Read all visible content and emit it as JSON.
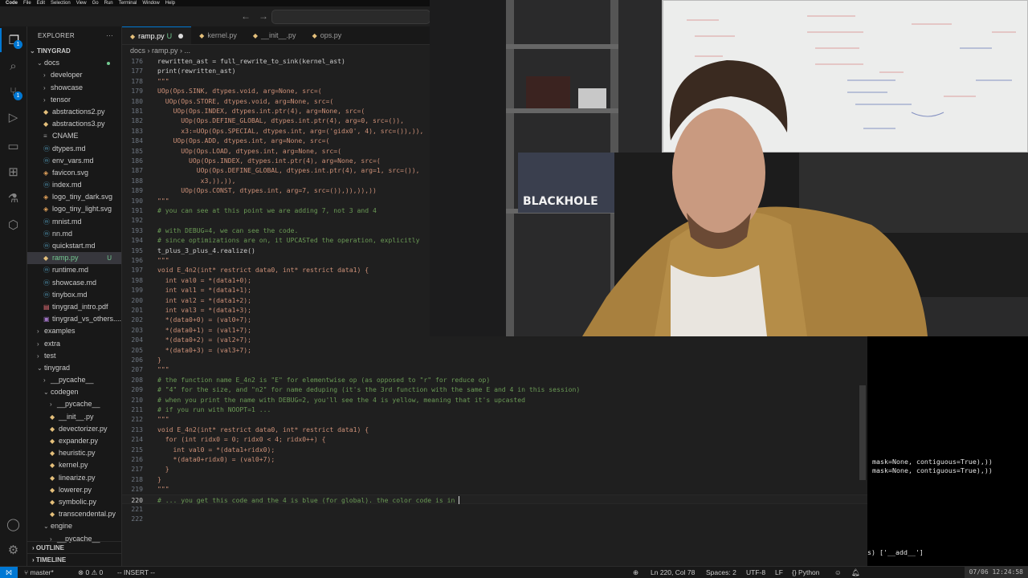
{
  "mac_menu": [
    "Code",
    "File",
    "Edit",
    "Selection",
    "View",
    "Go",
    "Run",
    "Terminal",
    "Window",
    "Help"
  ],
  "explorer": {
    "title": "EXPLORER",
    "more": "···",
    "root": "TINYGRAD",
    "items": [
      {
        "label": "docs",
        "level": 1,
        "kind": "folder",
        "open": true,
        "dot": true
      },
      {
        "label": "developer",
        "level": 2,
        "kind": "folder"
      },
      {
        "label": "showcase",
        "level": 2,
        "kind": "folder"
      },
      {
        "label": "tensor",
        "level": 2,
        "kind": "folder"
      },
      {
        "label": "abstractions2.py",
        "level": 2,
        "kind": "py"
      },
      {
        "label": "abstractions3.py",
        "level": 2,
        "kind": "py"
      },
      {
        "label": "CNAME",
        "level": 2,
        "kind": "txt"
      },
      {
        "label": "dtypes.md",
        "level": 2,
        "kind": "md"
      },
      {
        "label": "env_vars.md",
        "level": 2,
        "kind": "md"
      },
      {
        "label": "favicon.svg",
        "level": 2,
        "kind": "svg"
      },
      {
        "label": "index.md",
        "level": 2,
        "kind": "md"
      },
      {
        "label": "logo_tiny_dark.svg",
        "level": 2,
        "kind": "svg"
      },
      {
        "label": "logo_tiny_light.svg",
        "level": 2,
        "kind": "svg"
      },
      {
        "label": "mnist.md",
        "level": 2,
        "kind": "md"
      },
      {
        "label": "nn.md",
        "level": 2,
        "kind": "md"
      },
      {
        "label": "quickstart.md",
        "level": 2,
        "kind": "md"
      },
      {
        "label": "ramp.py",
        "level": 2,
        "kind": "py",
        "selected": true,
        "git": "U"
      },
      {
        "label": "runtime.md",
        "level": 2,
        "kind": "md"
      },
      {
        "label": "showcase.md",
        "level": 2,
        "kind": "md"
      },
      {
        "label": "tinybox.md",
        "level": 2,
        "kind": "md"
      },
      {
        "label": "tinygrad_intro.pdf",
        "level": 2,
        "kind": "pdf"
      },
      {
        "label": "tinygrad_vs_others....",
        "level": 2,
        "kind": "img"
      },
      {
        "label": "examples",
        "level": 1,
        "kind": "folder"
      },
      {
        "label": "extra",
        "level": 1,
        "kind": "folder"
      },
      {
        "label": "test",
        "level": 1,
        "kind": "folder"
      },
      {
        "label": "tinygrad",
        "level": 1,
        "kind": "folder",
        "open": true
      },
      {
        "label": "__pycache__",
        "level": 2,
        "kind": "folder"
      },
      {
        "label": "codegen",
        "level": 2,
        "kind": "folder",
        "open": true
      },
      {
        "label": "__pycache__",
        "level": 3,
        "kind": "folder"
      },
      {
        "label": "__init__.py",
        "level": 3,
        "kind": "py"
      },
      {
        "label": "devectorizer.py",
        "level": 3,
        "kind": "py"
      },
      {
        "label": "expander.py",
        "level": 3,
        "kind": "py"
      },
      {
        "label": "heuristic.py",
        "level": 3,
        "kind": "py"
      },
      {
        "label": "kernel.py",
        "level": 3,
        "kind": "py"
      },
      {
        "label": "linearize.py",
        "level": 3,
        "kind": "py"
      },
      {
        "label": "lowerer.py",
        "level": 3,
        "kind": "py"
      },
      {
        "label": "symbolic.py",
        "level": 3,
        "kind": "py"
      },
      {
        "label": "transcendental.py",
        "level": 3,
        "kind": "py"
      },
      {
        "label": "engine",
        "level": 2,
        "kind": "folder",
        "open": true
      },
      {
        "label": "__pycache__",
        "level": 3,
        "kind": "folder"
      }
    ],
    "outline": "OUTLINE",
    "timeline": "TIMELINE"
  },
  "tabs": [
    {
      "label": "ramp.py",
      "suffix": "U",
      "active": true
    },
    {
      "label": "kernel.py"
    },
    {
      "label": "__init__.py"
    },
    {
      "label": "ops.py"
    }
  ],
  "breadcrumb": "docs  ›  ramp.py  ›  ...",
  "code": [
    {
      "n": "176",
      "t": "rewritten_ast = full_rewrite_to_sink(kernel_ast)",
      "c": ""
    },
    {
      "n": "177",
      "t": "print(rewritten_ast)",
      "c": ""
    },
    {
      "n": "178",
      "t": "\"\"\"",
      "c": "str"
    },
    {
      "n": "179",
      "t": "UOp(Ops.SINK, dtypes.void, arg=None, src=(",
      "c": "str"
    },
    {
      "n": "180",
      "t": "  UOp(Ops.STORE, dtypes.void, arg=None, src=(",
      "c": "str"
    },
    {
      "n": "181",
      "t": "    UOp(Ops.INDEX, dtypes.int.ptr(4), arg=None, src=(",
      "c": "str"
    },
    {
      "n": "182",
      "t": "      UOp(Ops.DEFINE_GLOBAL, dtypes.int.ptr(4), arg=0, src=()),",
      "c": "str"
    },
    {
      "n": "183",
      "t": "      x3:=UOp(Ops.SPECIAL, dtypes.int, arg=('gidx0', 4), src=()),)),",
      "c": "str"
    },
    {
      "n": "184",
      "t": "    UOp(Ops.ADD, dtypes.int, arg=None, src=(",
      "c": "str"
    },
    {
      "n": "185",
      "t": "      UOp(Ops.LOAD, dtypes.int, arg=None, src=(",
      "c": "str"
    },
    {
      "n": "186",
      "t": "        UOp(Ops.INDEX, dtypes.int.ptr(4), arg=None, src=(",
      "c": "str"
    },
    {
      "n": "187",
      "t": "          UOp(Ops.DEFINE_GLOBAL, dtypes.int.ptr(4), arg=1, src=()),",
      "c": "str"
    },
    {
      "n": "188",
      "t": "           x3,)),)),",
      "c": "str"
    },
    {
      "n": "189",
      "t": "      UOp(Ops.CONST, dtypes.int, arg=7, src=()),)),)),))",
      "c": "str"
    },
    {
      "n": "190",
      "t": "\"\"\"",
      "c": "str"
    },
    {
      "n": "191",
      "t": "# you can see at this point we are adding 7, not 3 and 4",
      "c": "cmt"
    },
    {
      "n": "192",
      "t": "",
      "c": ""
    },
    {
      "n": "193",
      "t": "# with DEBUG=4, we can see the code.",
      "c": "cmt"
    },
    {
      "n": "194",
      "t": "# since optimizations are on, it UPCASTed the operation, explicitly",
      "c": "cmt"
    },
    {
      "n": "195",
      "t": "t_plus_3_plus_4.realize()",
      "c": ""
    },
    {
      "n": "196",
      "t": "\"\"\"",
      "c": "str"
    },
    {
      "n": "197",
      "t": "void E_4n2(int* restrict data0, int* restrict data1) {",
      "c": "str"
    },
    {
      "n": "198",
      "t": "  int val0 = *(data1+0);",
      "c": "str"
    },
    {
      "n": "199",
      "t": "  int val1 = *(data1+1);",
      "c": "str"
    },
    {
      "n": "200",
      "t": "  int val2 = *(data1+2);",
      "c": "str"
    },
    {
      "n": "201",
      "t": "  int val3 = *(data1+3);",
      "c": "str"
    },
    {
      "n": "202",
      "t": "  *(data0+0) = (val0+7);",
      "c": "str"
    },
    {
      "n": "203",
      "t": "  *(data0+1) = (val1+7);",
      "c": "str"
    },
    {
      "n": "204",
      "t": "  *(data0+2) = (val2+7);",
      "c": "str"
    },
    {
      "n": "205",
      "t": "  *(data0+3) = (val3+7);",
      "c": "str"
    },
    {
      "n": "206",
      "t": "}",
      "c": "str"
    },
    {
      "n": "207",
      "t": "\"\"\"",
      "c": "str"
    },
    {
      "n": "208",
      "t": "# the function name E_4n2 is \"E\" for elementwise op (as opposed to \"r\" for reduce op)",
      "c": "cmt"
    },
    {
      "n": "209",
      "t": "# \"4\" for the size, and \"n2\" for name deduping (it's the 3rd function with the same E and 4 in this session)",
      "c": "cmt"
    },
    {
      "n": "210",
      "t": "# when you print the name with DEBUG=2, you'll see the 4 is yellow, meaning that it's upcasted",
      "c": "cmt"
    },
    {
      "n": "211",
      "t": "# if you run with NOOPT=1 ...",
      "c": "cmt"
    },
    {
      "n": "212",
      "t": "\"\"\"",
      "c": "str"
    },
    {
      "n": "213",
      "t": "void E_4n2(int* restrict data0, int* restrict data1) {",
      "c": "str"
    },
    {
      "n": "214",
      "t": "  for (int ridx0 = 0; ridx0 < 4; ridx0++) {",
      "c": "str"
    },
    {
      "n": "215",
      "t": "    int val0 = *(data1+ridx0);",
      "c": "str"
    },
    {
      "n": "216",
      "t": "    *(data0+ridx0) = (val0+7);",
      "c": "str"
    },
    {
      "n": "217",
      "t": "  }",
      "c": "str"
    },
    {
      "n": "218",
      "t": "}",
      "c": "str"
    },
    {
      "n": "219",
      "t": "\"\"\"",
      "c": "str"
    },
    {
      "n": "220",
      "t": "# ... you get this code and the 4 is blue (for global). the color code is in ",
      "c": "cmt",
      "current": true
    },
    {
      "n": "221",
      "t": "",
      "c": ""
    },
    {
      "n": "222",
      "t": "",
      "c": ""
    }
  ],
  "webcam": {
    "sign": "BLACKHOLE"
  },
  "terminal": {
    "lines": [
      "mask=None, contiguous=True),))",
      "mask=None, contiguous=True),))"
    ],
    "last": "s) ['__add__']"
  },
  "status": {
    "branch": "master*",
    "problems": "⊗ 0 ⚠ 0",
    "mode": "-- INSERT --",
    "position": "Ln 220, Col 78",
    "spaces": "Spaces: 2",
    "encoding": "UTF-8",
    "eol": "LF",
    "language": "Python",
    "clock": "07/06  12:24:58"
  },
  "colors": {
    "accent": "#0078d4",
    "comment": "#6a9955",
    "string": "#ce9178",
    "git_untracked": "#73c991"
  }
}
